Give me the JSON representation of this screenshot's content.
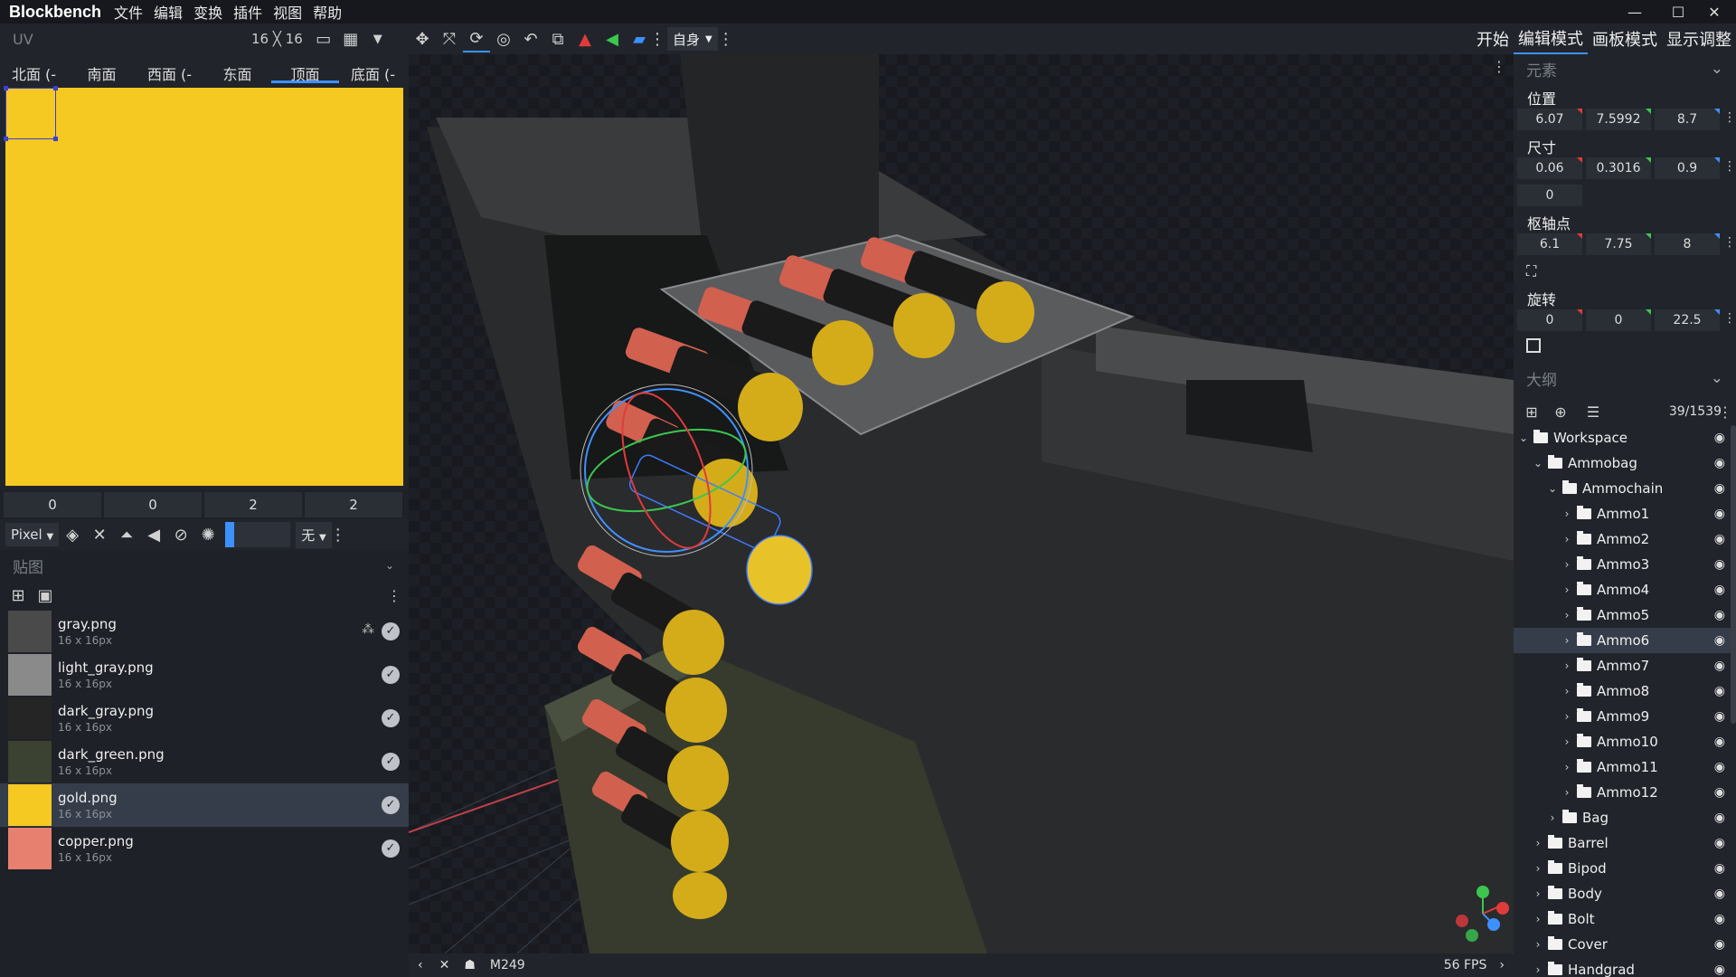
{
  "app": {
    "name": "Blockbench"
  },
  "menu": [
    "文件",
    "编辑",
    "变换",
    "插件",
    "视图",
    "帮助"
  ],
  "uv": {
    "title": "UV",
    "size": "16 ╳ 16",
    "faces": [
      "北面 (-",
      "南面",
      "西面 (-",
      "东面",
      "顶面",
      "底面 (-"
    ],
    "active_face": "顶面",
    "coords": [
      "0",
      "0",
      "2",
      "2"
    ],
    "fill_color": "#f6c822"
  },
  "paint": {
    "mode": "Pixel",
    "mirror": "无"
  },
  "toolbar": {
    "space": "自身"
  },
  "modes": [
    "开始",
    "编辑模式",
    "画板模式",
    "显示调整"
  ],
  "active_mode": "编辑模式",
  "textures": {
    "title": "贴图",
    "items": [
      {
        "name": "gray.png",
        "size": "16 x 16px",
        "color": "#4a4a4a"
      },
      {
        "name": "light_gray.png",
        "size": "16 x 16px",
        "color": "#8a8a8a"
      },
      {
        "name": "dark_gray.png",
        "size": "16 x 16px",
        "color": "#252525"
      },
      {
        "name": "dark_green.png",
        "size": "16 x 16px",
        "color": "#3b4231"
      },
      {
        "name": "gold.png",
        "size": "16 x 16px",
        "color": "#f6c822"
      },
      {
        "name": "copper.png",
        "size": "16 x 16px",
        "color": "#e88070"
      }
    ],
    "selected": "gold.png"
  },
  "element": {
    "title": "元素",
    "position_label": "位置",
    "position": [
      "6.07",
      "7.5992",
      "8.7"
    ],
    "size_label": "尺寸",
    "size": [
      "0.06",
      "0.3016",
      "0.9"
    ],
    "inflate": "0",
    "pivot_label": "枢轴点",
    "pivot": [
      "6.1",
      "7.75",
      "8"
    ],
    "rotation_label": "旋转",
    "rotation": [
      "0",
      "0",
      "22.5"
    ]
  },
  "outliner": {
    "title": "大纲",
    "count": "39/1539",
    "nodes": [
      {
        "label": "Workspace",
        "depth": 0,
        "open": true
      },
      {
        "label": "Ammobag",
        "depth": 1,
        "open": true
      },
      {
        "label": "Ammochain",
        "depth": 2,
        "open": true
      },
      {
        "label": "Ammo1",
        "depth": 3,
        "open": false
      },
      {
        "label": "Ammo2",
        "depth": 3,
        "open": false
      },
      {
        "label": "Ammo3",
        "depth": 3,
        "open": false
      },
      {
        "label": "Ammo4",
        "depth": 3,
        "open": false
      },
      {
        "label": "Ammo5",
        "depth": 3,
        "open": false
      },
      {
        "label": "Ammo6",
        "depth": 3,
        "open": false,
        "selected": true
      },
      {
        "label": "Ammo7",
        "depth": 3,
        "open": false
      },
      {
        "label": "Ammo8",
        "depth": 3,
        "open": false
      },
      {
        "label": "Ammo9",
        "depth": 3,
        "open": false
      },
      {
        "label": "Ammo10",
        "depth": 3,
        "open": false
      },
      {
        "label": "Ammo11",
        "depth": 3,
        "open": false
      },
      {
        "label": "Ammo12",
        "depth": 3,
        "open": false
      },
      {
        "label": "Bag",
        "depth": 2,
        "open": false
      },
      {
        "label": "Barrel",
        "depth": 1,
        "open": false
      },
      {
        "label": "Bipod",
        "depth": 1,
        "open": false
      },
      {
        "label": "Body",
        "depth": 1,
        "open": false
      },
      {
        "label": "Bolt",
        "depth": 1,
        "open": false
      },
      {
        "label": "Cover",
        "depth": 1,
        "open": false
      },
      {
        "label": "Handgrad",
        "depth": 1,
        "open": false
      }
    ]
  },
  "viewport": {
    "model_name": "M249",
    "fps": "56 FPS"
  }
}
